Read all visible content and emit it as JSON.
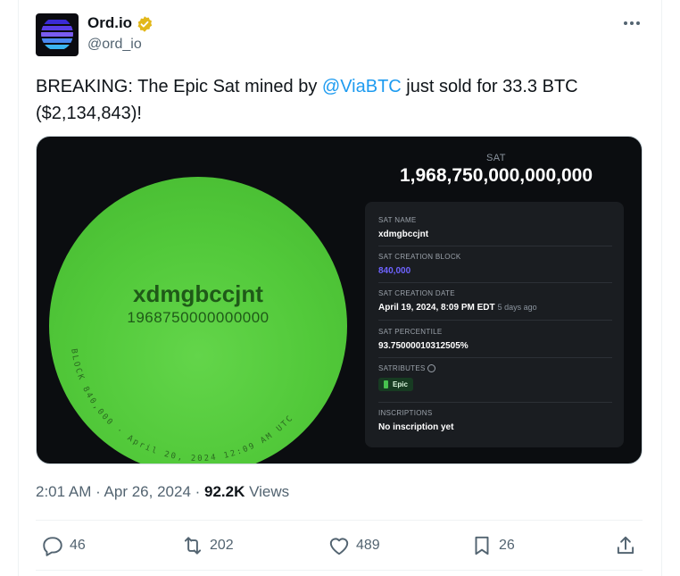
{
  "author": {
    "name": "Ord.io",
    "handle": "@ord_io"
  },
  "tweet": {
    "text_before": "BREAKING: The Epic Sat mined by ",
    "mention": "@ViaBTC",
    "text_after": " just sold for 33.3 BTC ($2,134,843)!"
  },
  "card": {
    "orb_name": "xdmgbccjnt",
    "orb_number": "1968750000000000",
    "orb_ring_text": "BLOCK 840,000 · April 20, 2024 12:09 AM UTC",
    "sat_label": "SAT",
    "sat_value": "1,968,750,000,000,000",
    "fields": [
      {
        "label": "SAT NAME",
        "value": "xdmgbccjnt"
      },
      {
        "label": "SAT CREATION BLOCK",
        "value": "840,000"
      },
      {
        "label": "SAT CREATION DATE",
        "value": "April 19, 2024, 8:09 PM EDT",
        "sub": "5 days ago"
      },
      {
        "label": "SAT PERCENTILE",
        "value": "93.75000010312505%"
      },
      {
        "label": "SATRIBUTES",
        "value": "Epic"
      },
      {
        "label": "INSCRIPTIONS",
        "value": "No inscription yet"
      }
    ]
  },
  "meta": {
    "time": "2:01 AM",
    "sep1": " · ",
    "date": "Apr 26, 2024",
    "sep2": " · ",
    "views_count": "92.2K",
    "views_label": " Views"
  },
  "actions": {
    "replies": "46",
    "retweets": "202",
    "likes": "489",
    "bookmarks": "26"
  },
  "colors": {
    "mention": "#1d9bf0",
    "orb_green": "#52c93a",
    "card_bg": "#0b0d10",
    "link_purple": "#6e63ff"
  }
}
